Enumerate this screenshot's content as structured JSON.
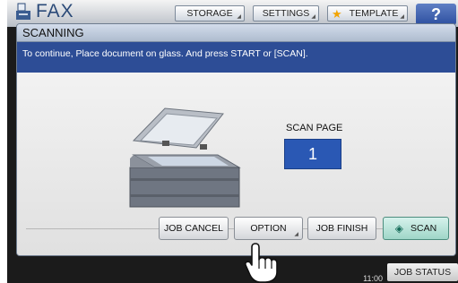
{
  "header": {
    "title": "FAX",
    "tabs": {
      "storage": "STORAGE",
      "settings": "SETTINGS",
      "template": "TEMPLATE"
    },
    "help": "?"
  },
  "dialog": {
    "title": "SCANNING",
    "message": "To continue, Place document on glass. And press START or [SCAN].",
    "scan_page_label": "SCAN PAGE",
    "scan_page_value": "1",
    "buttons": {
      "job_cancel": "JOB CANCEL",
      "option": "OPTION",
      "job_finish": "JOB FINISH",
      "scan": "SCAN"
    }
  },
  "status_bar": {
    "time": "11:00",
    "job_status": "JOB STATUS"
  },
  "colors": {
    "message_bg": "#2d4d96",
    "scan_counter_bg": "#2a58b4",
    "scan_button_bg": "#9fd6c8"
  }
}
